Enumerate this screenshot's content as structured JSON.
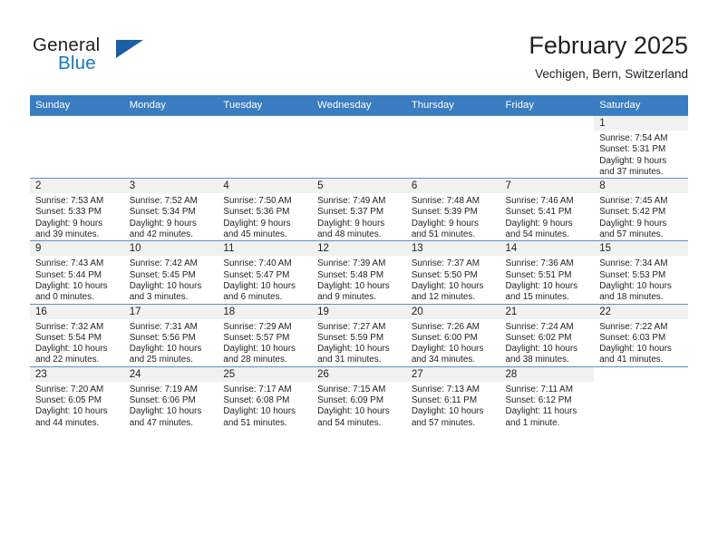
{
  "brand": {
    "name_top": "General",
    "name_bottom": "Blue",
    "triangle_color": "#1b5fa6",
    "blue_color": "#1b75bb"
  },
  "header": {
    "title": "February 2025",
    "subtitle": "Vechigen, Bern, Switzerland"
  },
  "theme": {
    "header_row_bg": "#3a7dc0",
    "header_row_text": "#ffffff",
    "day_number_bg": "#f1f1f1",
    "cell_border": "#5b90c7"
  },
  "weekdays": [
    "Sunday",
    "Monday",
    "Tuesday",
    "Wednesday",
    "Thursday",
    "Friday",
    "Saturday"
  ],
  "weeks": [
    [
      {
        "day": "",
        "empty": true,
        "blank": true,
        "sunrise": "",
        "sunset": "",
        "daylight1": "",
        "daylight2": ""
      },
      {
        "day": "",
        "empty": true,
        "blank": true,
        "sunrise": "",
        "sunset": "",
        "daylight1": "",
        "daylight2": ""
      },
      {
        "day": "",
        "empty": true,
        "blank": true,
        "sunrise": "",
        "sunset": "",
        "daylight1": "",
        "daylight2": ""
      },
      {
        "day": "",
        "empty": true,
        "blank": true,
        "sunrise": "",
        "sunset": "",
        "daylight1": "",
        "daylight2": ""
      },
      {
        "day": "",
        "empty": true,
        "blank": true,
        "sunrise": "",
        "sunset": "",
        "daylight1": "",
        "daylight2": ""
      },
      {
        "day": "",
        "empty": true,
        "blank": true,
        "sunrise": "",
        "sunset": "",
        "daylight1": "",
        "daylight2": ""
      },
      {
        "day": "1",
        "sunrise": "Sunrise: 7:54 AM",
        "sunset": "Sunset: 5:31 PM",
        "daylight1": "Daylight: 9 hours",
        "daylight2": "and 37 minutes."
      }
    ],
    [
      {
        "day": "2",
        "sunrise": "Sunrise: 7:53 AM",
        "sunset": "Sunset: 5:33 PM",
        "daylight1": "Daylight: 9 hours",
        "daylight2": "and 39 minutes."
      },
      {
        "day": "3",
        "sunrise": "Sunrise: 7:52 AM",
        "sunset": "Sunset: 5:34 PM",
        "daylight1": "Daylight: 9 hours",
        "daylight2": "and 42 minutes."
      },
      {
        "day": "4",
        "sunrise": "Sunrise: 7:50 AM",
        "sunset": "Sunset: 5:36 PM",
        "daylight1": "Daylight: 9 hours",
        "daylight2": "and 45 minutes."
      },
      {
        "day": "5",
        "sunrise": "Sunrise: 7:49 AM",
        "sunset": "Sunset: 5:37 PM",
        "daylight1": "Daylight: 9 hours",
        "daylight2": "and 48 minutes."
      },
      {
        "day": "6",
        "sunrise": "Sunrise: 7:48 AM",
        "sunset": "Sunset: 5:39 PM",
        "daylight1": "Daylight: 9 hours",
        "daylight2": "and 51 minutes."
      },
      {
        "day": "7",
        "sunrise": "Sunrise: 7:46 AM",
        "sunset": "Sunset: 5:41 PM",
        "daylight1": "Daylight: 9 hours",
        "daylight2": "and 54 minutes."
      },
      {
        "day": "8",
        "sunrise": "Sunrise: 7:45 AM",
        "sunset": "Sunset: 5:42 PM",
        "daylight1": "Daylight: 9 hours",
        "daylight2": "and 57 minutes."
      }
    ],
    [
      {
        "day": "9",
        "sunrise": "Sunrise: 7:43 AM",
        "sunset": "Sunset: 5:44 PM",
        "daylight1": "Daylight: 10 hours",
        "daylight2": "and 0 minutes."
      },
      {
        "day": "10",
        "sunrise": "Sunrise: 7:42 AM",
        "sunset": "Sunset: 5:45 PM",
        "daylight1": "Daylight: 10 hours",
        "daylight2": "and 3 minutes."
      },
      {
        "day": "11",
        "sunrise": "Sunrise: 7:40 AM",
        "sunset": "Sunset: 5:47 PM",
        "daylight1": "Daylight: 10 hours",
        "daylight2": "and 6 minutes."
      },
      {
        "day": "12",
        "sunrise": "Sunrise: 7:39 AM",
        "sunset": "Sunset: 5:48 PM",
        "daylight1": "Daylight: 10 hours",
        "daylight2": "and 9 minutes."
      },
      {
        "day": "13",
        "sunrise": "Sunrise: 7:37 AM",
        "sunset": "Sunset: 5:50 PM",
        "daylight1": "Daylight: 10 hours",
        "daylight2": "and 12 minutes."
      },
      {
        "day": "14",
        "sunrise": "Sunrise: 7:36 AM",
        "sunset": "Sunset: 5:51 PM",
        "daylight1": "Daylight: 10 hours",
        "daylight2": "and 15 minutes."
      },
      {
        "day": "15",
        "sunrise": "Sunrise: 7:34 AM",
        "sunset": "Sunset: 5:53 PM",
        "daylight1": "Daylight: 10 hours",
        "daylight2": "and 18 minutes."
      }
    ],
    [
      {
        "day": "16",
        "sunrise": "Sunrise: 7:32 AM",
        "sunset": "Sunset: 5:54 PM",
        "daylight1": "Daylight: 10 hours",
        "daylight2": "and 22 minutes."
      },
      {
        "day": "17",
        "sunrise": "Sunrise: 7:31 AM",
        "sunset": "Sunset: 5:56 PM",
        "daylight1": "Daylight: 10 hours",
        "daylight2": "and 25 minutes."
      },
      {
        "day": "18",
        "sunrise": "Sunrise: 7:29 AM",
        "sunset": "Sunset: 5:57 PM",
        "daylight1": "Daylight: 10 hours",
        "daylight2": "and 28 minutes."
      },
      {
        "day": "19",
        "sunrise": "Sunrise: 7:27 AM",
        "sunset": "Sunset: 5:59 PM",
        "daylight1": "Daylight: 10 hours",
        "daylight2": "and 31 minutes."
      },
      {
        "day": "20",
        "sunrise": "Sunrise: 7:26 AM",
        "sunset": "Sunset: 6:00 PM",
        "daylight1": "Daylight: 10 hours",
        "daylight2": "and 34 minutes."
      },
      {
        "day": "21",
        "sunrise": "Sunrise: 7:24 AM",
        "sunset": "Sunset: 6:02 PM",
        "daylight1": "Daylight: 10 hours",
        "daylight2": "and 38 minutes."
      },
      {
        "day": "22",
        "sunrise": "Sunrise: 7:22 AM",
        "sunset": "Sunset: 6:03 PM",
        "daylight1": "Daylight: 10 hours",
        "daylight2": "and 41 minutes."
      }
    ],
    [
      {
        "day": "23",
        "sunrise": "Sunrise: 7:20 AM",
        "sunset": "Sunset: 6:05 PM",
        "daylight1": "Daylight: 10 hours",
        "daylight2": "and 44 minutes."
      },
      {
        "day": "24",
        "sunrise": "Sunrise: 7:19 AM",
        "sunset": "Sunset: 6:06 PM",
        "daylight1": "Daylight: 10 hours",
        "daylight2": "and 47 minutes."
      },
      {
        "day": "25",
        "sunrise": "Sunrise: 7:17 AM",
        "sunset": "Sunset: 6:08 PM",
        "daylight1": "Daylight: 10 hours",
        "daylight2": "and 51 minutes."
      },
      {
        "day": "26",
        "sunrise": "Sunrise: 7:15 AM",
        "sunset": "Sunset: 6:09 PM",
        "daylight1": "Daylight: 10 hours",
        "daylight2": "and 54 minutes."
      },
      {
        "day": "27",
        "sunrise": "Sunrise: 7:13 AM",
        "sunset": "Sunset: 6:11 PM",
        "daylight1": "Daylight: 10 hours",
        "daylight2": "and 57 minutes."
      },
      {
        "day": "28",
        "sunrise": "Sunrise: 7:11 AM",
        "sunset": "Sunset: 6:12 PM",
        "daylight1": "Daylight: 11 hours",
        "daylight2": "and 1 minute."
      },
      {
        "day": "",
        "empty": true,
        "blank": true,
        "sunrise": "",
        "sunset": "",
        "daylight1": "",
        "daylight2": ""
      }
    ]
  ]
}
